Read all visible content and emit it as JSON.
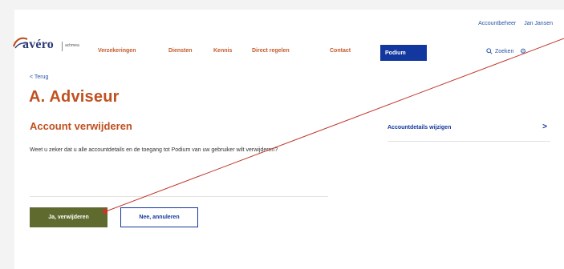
{
  "topbar": {
    "account": "Accountbeheer",
    "user": "Jan Jansen"
  },
  "logo": {
    "name": "avéro",
    "sub": "achmea"
  },
  "nav": {
    "items": [
      "Verzekeringen",
      "Diensten",
      "Kennis",
      "Direct regelen",
      "Contact"
    ],
    "active": "Podium",
    "search": "Zoeken"
  },
  "page": {
    "back": "< Terug",
    "title": "A. Adviseur",
    "subtitle": "Account verwijderen",
    "body": "Weet u zeker dat u alle accountdetails en de toegang tot Podium van uw gebruiker wilt verwijderen?",
    "confirm": "Ja, verwijderen",
    "cancel": "Nee, annuleren"
  },
  "side": {
    "link": "Accountdetails wijzigen",
    "chevron": ">"
  },
  "colors": {
    "accent_orange": "#c0501f",
    "brand_blue": "#12379e",
    "confirm_green": "#5f6a2e",
    "annotation_red": "#c0392b"
  }
}
